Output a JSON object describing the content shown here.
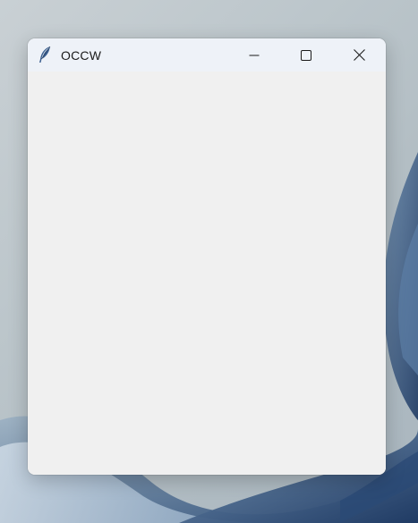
{
  "window": {
    "title": "OCCW",
    "app_icon": "feather-icon",
    "controls": {
      "minimize": "minimize-icon",
      "maximize": "maximize-icon",
      "close": "close-icon"
    }
  },
  "colors": {
    "titlebar": "#eef2f8",
    "client_background": "#f0f0f0",
    "title_text": "#1a1a1a"
  }
}
